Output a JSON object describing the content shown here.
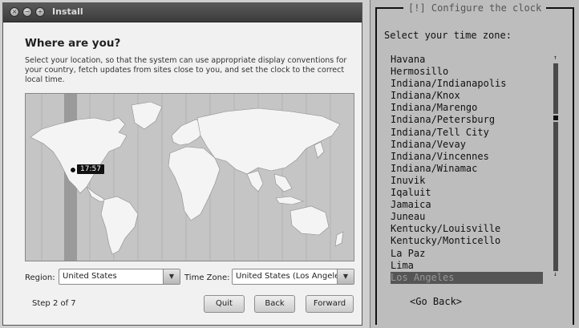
{
  "installer": {
    "window_title": "Install",
    "heading": "Where are you?",
    "description": "Select your location, so that the system can use appropriate display conventions for your country, fetch updates from sites close to you, and set the clock to the correct local time.",
    "map_time": "17:57",
    "region_label": "Region:",
    "region_value": "United States",
    "timezone_label": "Time Zone:",
    "timezone_value": "United States (Los Angeles)",
    "step": "Step 2 of 7",
    "buttons": {
      "quit": "Quit",
      "back": "Back",
      "forward": "Forward"
    }
  },
  "console": {
    "title": "[!] Configure the clock",
    "prompt": "Select your time zone:",
    "timezones": [
      "Havana",
      "Hermosillo",
      "Indiana/Indianapolis",
      "Indiana/Knox",
      "Indiana/Marengo",
      "Indiana/Petersburg",
      "Indiana/Tell City",
      "Indiana/Vevay",
      "Indiana/Vincennes",
      "Indiana/Winamac",
      "Inuvik",
      "Iqaluit",
      "Jamaica",
      "Juneau",
      "Kentucky/Louisville",
      "Kentucky/Monticello",
      "La Paz",
      "Lima",
      "Los Angeles"
    ],
    "selected_timezone": "Los Angeles",
    "scroll_up": "↑",
    "scroll_down": "↓",
    "go_back": "<Go Back>"
  }
}
